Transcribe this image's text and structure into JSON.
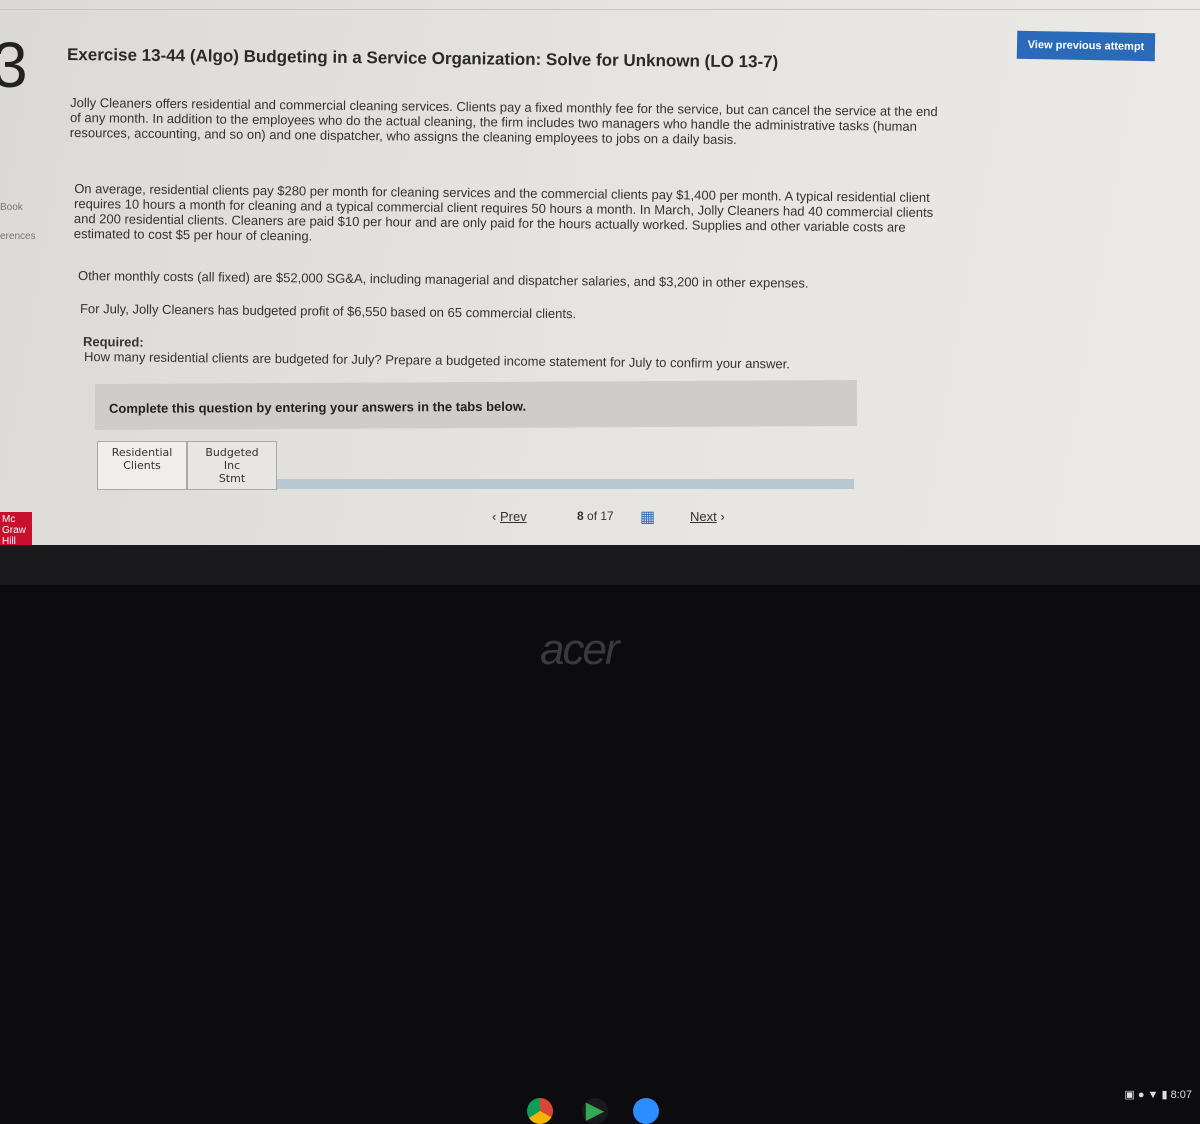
{
  "question_number": "3",
  "left_links": [
    "Book",
    "erences"
  ],
  "title": "Exercise 13-44 (Algo) Budgeting in a Service Organization: Solve for Unknown (LO 13-7)",
  "view_previous_attempt": "View previous attempt",
  "paragraphs": [
    "Jolly Cleaners offers residential and commercial cleaning services. Clients pay a fixed monthly fee for the service, but can cancel the service at the end of any month. In addition to the employees who do the actual cleaning, the firm includes two managers who handle the administrative tasks (human resources, accounting, and so on) and one dispatcher, who assigns the cleaning employees to jobs on a daily basis.",
    "On average, residential clients pay $280 per month for cleaning services and the commercial clients pay $1,400 per month. A typical residential client requires 10 hours a month for cleaning and a typical commercial client requires 50 hours a month. In March, Jolly Cleaners had 40 commercial clients and 200 residential clients. Cleaners are paid $10 per hour and are only paid for the hours actually worked. Supplies and other variable costs are estimated to cost $5 per hour of cleaning.",
    "Other monthly costs (all fixed) are $52,000 SG&A, including managerial and dispatcher salaries, and $3,200 in other expenses.",
    "For July, Jolly Cleaners has budgeted profit of $6,550 based on 65 commercial clients."
  ],
  "required_label": "Required:",
  "required_text": "How many residential clients are budgeted for July? Prepare a budgeted income statement for July to confirm your answer.",
  "instruction": "Complete this question by entering your answers in the tabs below.",
  "tabs": [
    {
      "line1": "Residential",
      "line2": "Clients"
    },
    {
      "line1": "Budgeted Inc",
      "line2": "Stmt"
    }
  ],
  "nav": {
    "prev": "Prev",
    "page": "8",
    "of": "of 17",
    "next": "Next"
  },
  "logo": "Mc Graw Hill",
  "status": {
    "time": "8:07"
  },
  "brand": "acer"
}
